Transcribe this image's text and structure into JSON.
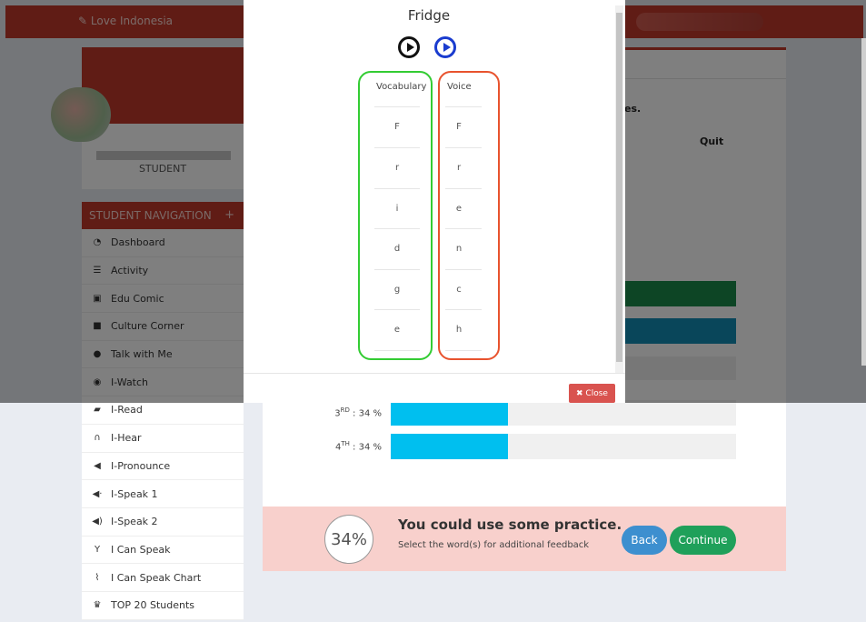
{
  "header": {
    "brand": "Love Indonesia"
  },
  "profile": {
    "role": "STUDENT"
  },
  "nav": {
    "title": "STUDENT NAVIGATION",
    "toggle": "+",
    "items": [
      {
        "label": "Dashboard",
        "icon": "dashboard-icon",
        "glyph": "◔"
      },
      {
        "label": "Activity",
        "icon": "list-icon",
        "glyph": "☰"
      },
      {
        "label": "Edu Comic",
        "icon": "image-icon",
        "glyph": "▣"
      },
      {
        "label": "Culture Corner",
        "icon": "video-camera-icon",
        "glyph": "■"
      },
      {
        "label": "Talk with Me",
        "icon": "chat-icon",
        "glyph": "●"
      },
      {
        "label": "I-Watch",
        "icon": "eye-icon",
        "glyph": "◉"
      },
      {
        "label": "I-Read",
        "icon": "book-icon",
        "glyph": "▰"
      },
      {
        "label": "I-Hear",
        "icon": "headphones-icon",
        "glyph": "∩"
      },
      {
        "label": "I-Pronounce",
        "icon": "speaker-off-icon",
        "glyph": "◀"
      },
      {
        "label": "I-Speak 1",
        "icon": "speaker-low-icon",
        "glyph": "◀·"
      },
      {
        "label": "I-Speak 2",
        "icon": "speaker-high-icon",
        "glyph": "◀)"
      },
      {
        "label": "I Can Speak",
        "icon": "person-icon",
        "glyph": "Y"
      },
      {
        "label": "I Can Speak Chart",
        "icon": "line-chart-icon",
        "glyph": "⌇"
      },
      {
        "label": "TOP 20 Students",
        "icon": "trophy-icon",
        "glyph": "♛"
      }
    ]
  },
  "background": {
    "partial_text": "es.",
    "quit_label": "Quit",
    "scores": [
      {
        "ord": "3",
        "suffix": "RD",
        "value": "34 %",
        "percent": 34
      },
      {
        "ord": "4",
        "suffix": "TH",
        "value": "34 %",
        "percent": 34
      }
    ]
  },
  "result": {
    "percent": "34%",
    "title": "You could use some practice.",
    "subtitle": "Select the word(s) for additional feedback",
    "back_label": "Back",
    "continue_label": "Continue"
  },
  "modal": {
    "title": "Fridge",
    "vocabulary_header": "Vocabulary",
    "voice_header": "Voice",
    "vocabulary_letters": [
      "F",
      "r",
      "i",
      "d",
      "g",
      "e"
    ],
    "voice_letters": [
      "F",
      "r",
      "e",
      "n",
      "c",
      "h"
    ],
    "close_label": "✖ Close"
  },
  "colors": {
    "brand_red": "#c0392b",
    "vocab_border": "#33cc33",
    "voice_border": "#e8532e",
    "score_bar": "#00bfef",
    "back_button": "#3d8fcf",
    "continue_button": "#1fa05a"
  }
}
